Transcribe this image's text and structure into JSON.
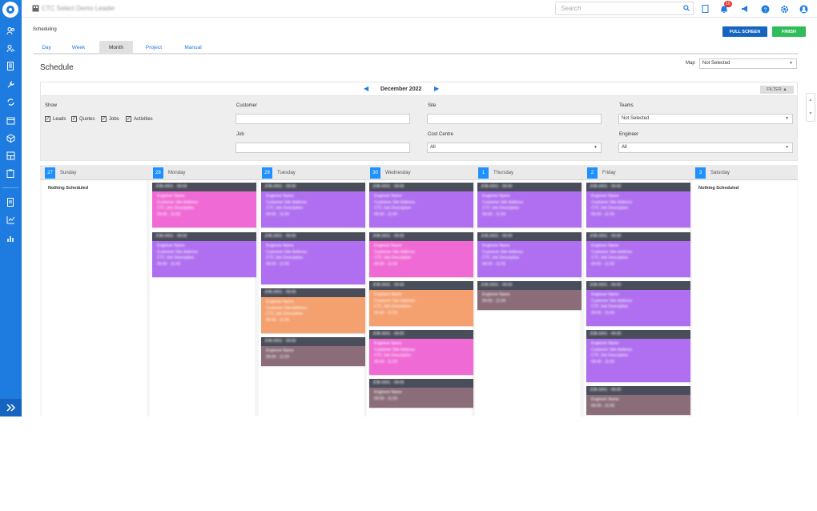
{
  "app": {
    "window_title": "CTC Select Demo Leader"
  },
  "search": {
    "placeholder": "Search"
  },
  "notifications": {
    "count": "10"
  },
  "breadcrumb": "Scheduling",
  "buttons": {
    "full_screen": "FULL SCREEN",
    "finish": "FINISH"
  },
  "tabs": [
    {
      "label": "Day"
    },
    {
      "label": "Week"
    },
    {
      "label": "Month"
    },
    {
      "label": "Project"
    },
    {
      "label": "Manual"
    }
  ],
  "active_tab": "Month",
  "page_title": "Schedule",
  "map": {
    "label": "Map",
    "value": "Not Selected"
  },
  "month_nav": {
    "label": "December 2022",
    "prev": "◀",
    "next": "▶"
  },
  "filter_button": "FILTER ▲",
  "filters": {
    "show_label": "Show",
    "show_options": [
      {
        "label": "Leads",
        "checked": true
      },
      {
        "label": "Quotes",
        "checked": true
      },
      {
        "label": "Jobs",
        "checked": true
      },
      {
        "label": "Activities",
        "checked": true
      }
    ],
    "customer_label": "Customer",
    "customer_value": "",
    "job_label": "Job",
    "job_value": "",
    "site_label": "Site",
    "site_value": "",
    "cost_centre_label": "Cost Centre",
    "cost_centre_value": "All",
    "teams_label": "Teams",
    "teams_value": "Not Selected",
    "engineer_label": "Engineer",
    "engineer_value": "All"
  },
  "calendar": {
    "days": [
      {
        "num": "27",
        "name": "Sunday",
        "empty_text": "Nothing Scheduled"
      },
      {
        "num": "28",
        "name": "Monday"
      },
      {
        "num": "29",
        "name": "Tuesday"
      },
      {
        "num": "30",
        "name": "Wednesday"
      },
      {
        "num": "1",
        "name": "Thursday"
      },
      {
        "num": "2",
        "name": "Friday"
      },
      {
        "num": "3",
        "name": "Saturday",
        "empty_text": "Nothing Scheduled"
      }
    ],
    "card_colors": {
      "purple": "#b06ff0",
      "pink": "#f06ad6",
      "orange": "#f5a06f",
      "mauve": "#8a6d79",
      "header": "#4a4e5a"
    },
    "card_placeholder": {
      "head": "JOB-0001 · 09:00",
      "lines": [
        "Engineer Name",
        "Customer Site Address",
        "CTC Job Description",
        "09:00 - 11:00"
      ]
    }
  },
  "colors": {
    "brand": "#1e7be0",
    "finish": "#2ebd59",
    "full_screen": "#1565c0"
  }
}
